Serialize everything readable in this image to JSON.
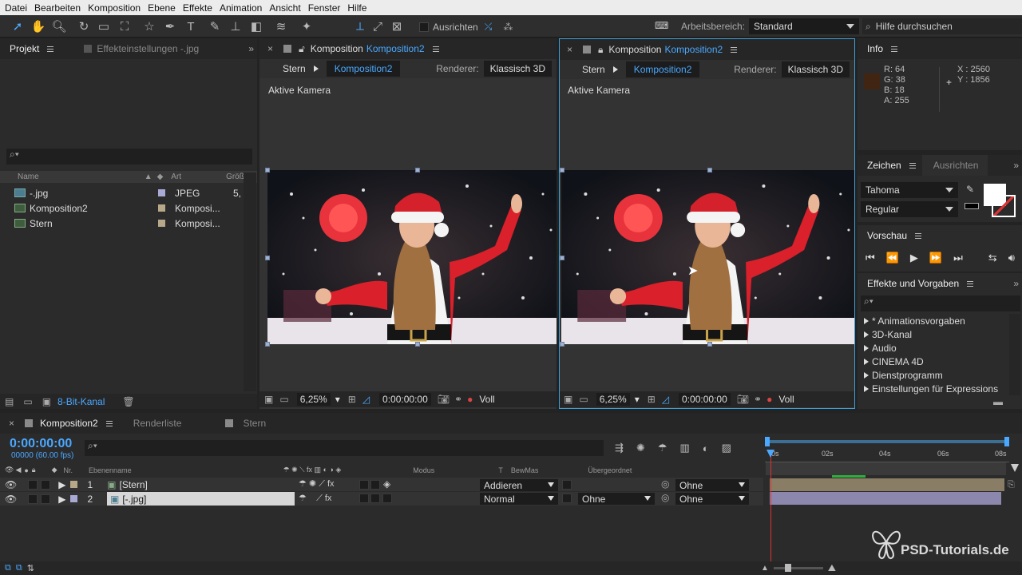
{
  "menu": [
    "Datei",
    "Bearbeiten",
    "Komposition",
    "Ebene",
    "Effekte",
    "Animation",
    "Ansicht",
    "Fenster",
    "Hilfe"
  ],
  "toolbar": {
    "align_label": "Ausrichten",
    "workspace_label": "Arbeitsbereich:",
    "workspace_value": "Standard",
    "help_placeholder": "Hilfe durchsuchen"
  },
  "project_panel": {
    "tab_project": "Projekt",
    "tab_effects": "Effekteinstellungen -.jpg",
    "columns": {
      "name": "Name",
      "type": "Art",
      "size": "Größe"
    },
    "items": [
      {
        "name": "-.jpg",
        "type": "JPEG",
        "size": "5,",
        "color": "#a9a9d6"
      },
      {
        "name": "Komposition2",
        "type": "Komposi...",
        "size": "",
        "color": "#b7a88a"
      },
      {
        "name": "Stern",
        "type": "Komposi...",
        "size": "",
        "color": "#b7a88a"
      }
    ],
    "bit_depth": "8-Bit-Kanal"
  },
  "viewer_left": {
    "title_prefix": "Komposition",
    "title_comp": "Komposition2",
    "breadcrumb_1": "Stern",
    "breadcrumb_2": "Komposition2",
    "renderer_label": "Renderer:",
    "renderer_value": "Klassisch 3D",
    "camera_label": "Aktive Kamera",
    "zoom": "6,25%",
    "timecode": "0:00:00:00",
    "resolution": "Voll"
  },
  "viewer_right": {
    "title_prefix": "Komposition",
    "title_comp": "Komposition2",
    "breadcrumb_1": "Stern",
    "breadcrumb_2": "Komposition2",
    "renderer_label": "Renderer:",
    "renderer_value": "Klassisch 3D",
    "camera_label": "Aktive Kamera",
    "zoom": "6,25%",
    "timecode": "0:00:00:00",
    "resolution": "Voll"
  },
  "info": {
    "title": "Info",
    "r": "R:  64",
    "g": "G:  38",
    "b": "B:  18",
    "a": "A:  255",
    "x": "X : 2560",
    "y": "Y : 1856",
    "swatch": "#402612"
  },
  "character": {
    "tab_char": "Zeichen",
    "tab_align": "Ausrichten",
    "font": "Tahoma",
    "style": "Regular"
  },
  "preview": {
    "title": "Vorschau"
  },
  "effects": {
    "title": "Effekte und Vorgaben",
    "items": [
      "* Animationsvorgaben",
      "3D-Kanal",
      "Audio",
      "CINEMA 4D",
      "Dienstprogramm",
      "Einstellungen für Expressions"
    ]
  },
  "timeline": {
    "tab_comp": "Komposition2",
    "tab_render": "Renderliste",
    "tab_stern": "Stern",
    "timecode": "0:00:00:00",
    "fps": "00000 (60.00 fps)",
    "col_nr": "Nr.",
    "col_name": "Ebenenname",
    "col_mode": "Modus",
    "col_t": "T",
    "col_trkmat": "BewMas",
    "col_parent": "Übergeordnet",
    "ruler": [
      "0s",
      "02s",
      "04s",
      "06s",
      "08s"
    ],
    "layers": [
      {
        "nr": "1",
        "name": "[Stern]",
        "mode": "Addieren",
        "trkmat": "",
        "parent": "Ohne",
        "color": "#b7a88a"
      },
      {
        "nr": "2",
        "name": "[-.jpg]",
        "mode": "Normal",
        "trkmat": "Ohne",
        "parent": "Ohne",
        "color": "#a9a9d6"
      }
    ]
  },
  "watermark": "PSD-Tutorials.de"
}
